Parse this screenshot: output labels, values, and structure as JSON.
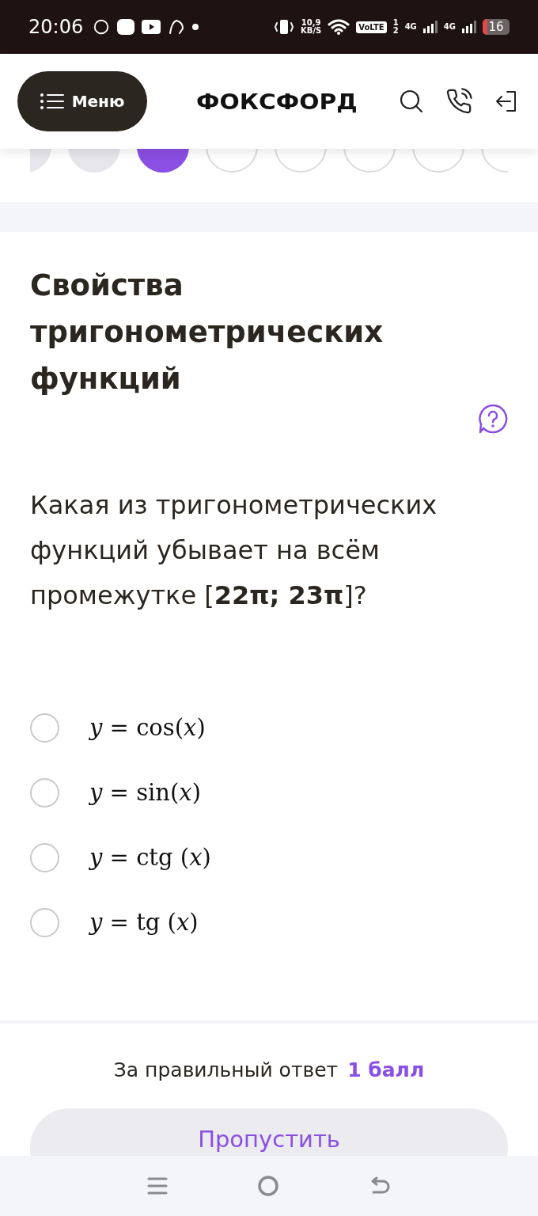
{
  "status_bar": {
    "time": "20:06",
    "network_speed": "10,9",
    "network_speed_unit": "KB/S",
    "volte": "VoLTE",
    "sim_1": "1",
    "sim_2": "2",
    "signal_1": "4G",
    "signal_2": "4G",
    "battery": "16"
  },
  "header": {
    "menu_label": "Меню",
    "logo": "ФОКСФОРД"
  },
  "pager": [
    {
      "selected": false,
      "answered": true
    },
    {
      "selected": false,
      "answered": true
    },
    {
      "selected": true,
      "answered": false
    },
    {
      "selected": false,
      "answered": false
    },
    {
      "selected": false,
      "answered": false
    },
    {
      "selected": false,
      "answered": false
    },
    {
      "selected": false,
      "answered": false
    },
    {
      "selected": false,
      "answered": false
    }
  ],
  "task": {
    "title": "Свойства тригонометрических функций",
    "question": "Какая из тригонометрических функций убывает на всём промежутке [**22π; 23π**]?",
    "options": [
      {
        "formula": "*y* = cos(*x*)",
        "selected": false
      },
      {
        "formula": "*y* = sin(*x*)",
        "selected": false
      },
      {
        "formula": "*y* = ctg (*x*)",
        "selected": false
      },
      {
        "formula": "*y* = tg (*x*)",
        "selected": false
      }
    ]
  },
  "footer": {
    "score_label": "За правильный ответ",
    "score_value": "1 балл",
    "skip_button": "Пропустить"
  }
}
